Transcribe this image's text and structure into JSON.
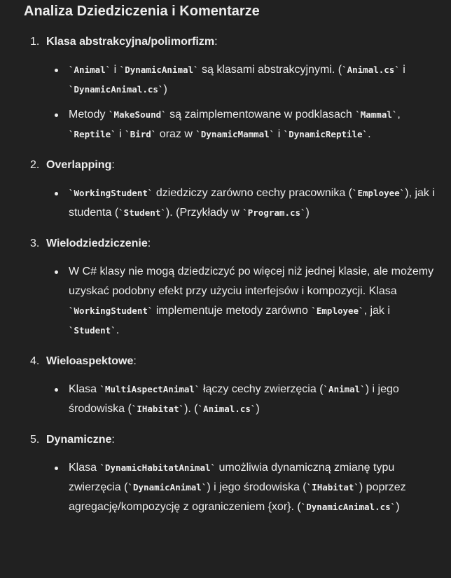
{
  "title": "Analiza Dziedziczenia i Komentarze",
  "sections": [
    {
      "number": "1.",
      "title": "Klasa abstrakcyjna/polimorfizm",
      "bullets": [
        [
          {
            "t": "code",
            "v": "`Animal`"
          },
          {
            "t": "text",
            "v": " i "
          },
          {
            "t": "code",
            "v": "`DynamicAnimal`"
          },
          {
            "t": "text",
            "v": " są klasami abstrakcyjnymi. ("
          },
          {
            "t": "code",
            "v": "`Animal.cs`"
          },
          {
            "t": "text",
            "v": " i "
          },
          {
            "t": "code",
            "v": "`DynamicAnimal.cs`"
          },
          {
            "t": "text",
            "v": ")"
          }
        ],
        [
          {
            "t": "text",
            "v": "Metody "
          },
          {
            "t": "code",
            "v": "`MakeSound`"
          },
          {
            "t": "text",
            "v": " są zaimplementowane w podklasach "
          },
          {
            "t": "code",
            "v": "`Mammal`"
          },
          {
            "t": "text",
            "v": ", "
          },
          {
            "t": "code",
            "v": "`Reptile`"
          },
          {
            "t": "text",
            "v": " i "
          },
          {
            "t": "code",
            "v": "`Bird`"
          },
          {
            "t": "text",
            "v": " oraz w "
          },
          {
            "t": "code",
            "v": "`DynamicMammal`"
          },
          {
            "t": "text",
            "v": " i "
          },
          {
            "t": "code",
            "v": "`DynamicReptile`"
          },
          {
            "t": "text",
            "v": "."
          }
        ]
      ]
    },
    {
      "number": "2.",
      "title": "Overlapping",
      "bullets": [
        [
          {
            "t": "code",
            "v": "`WorkingStudent`"
          },
          {
            "t": "text",
            "v": " dziedziczy zarówno cechy pracownika ("
          },
          {
            "t": "code",
            "v": "`Employee`"
          },
          {
            "t": "text",
            "v": "), jak i studenta ("
          },
          {
            "t": "code",
            "v": "`Student`"
          },
          {
            "t": "text",
            "v": "). (Przykłady w "
          },
          {
            "t": "code",
            "v": "`Program.cs`"
          },
          {
            "t": "text",
            "v": ")"
          }
        ]
      ]
    },
    {
      "number": "3.",
      "title": "Wielodziedziczenie",
      "bullets": [
        [
          {
            "t": "text",
            "v": "W C# klasy nie mogą dziedziczyć po więcej niż jednej klasie, ale możemy uzyskać podobny efekt przy użyciu interfejsów i kompozycji. Klasa "
          },
          {
            "t": "code",
            "v": "`WorkingStudent`"
          },
          {
            "t": "text",
            "v": " implementuje metody zarówno "
          },
          {
            "t": "code",
            "v": "`Employee`"
          },
          {
            "t": "text",
            "v": ", jak i "
          },
          {
            "t": "code",
            "v": "`Student`"
          },
          {
            "t": "text",
            "v": "."
          }
        ]
      ]
    },
    {
      "number": "4.",
      "title": "Wieloaspektowe",
      "bullets": [
        [
          {
            "t": "text",
            "v": "Klasa "
          },
          {
            "t": "code",
            "v": "`MultiAspectAnimal`"
          },
          {
            "t": "text",
            "v": " łączy cechy zwierzęcia ("
          },
          {
            "t": "code",
            "v": "`Animal`"
          },
          {
            "t": "text",
            "v": ") i jego środowiska ("
          },
          {
            "t": "code",
            "v": "`IHabitat`"
          },
          {
            "t": "text",
            "v": "). ("
          },
          {
            "t": "code",
            "v": "`Animal.cs`"
          },
          {
            "t": "text",
            "v": ")"
          }
        ]
      ]
    },
    {
      "number": "5.",
      "title": "Dynamiczne",
      "bullets": [
        [
          {
            "t": "text",
            "v": "Klasa "
          },
          {
            "t": "code",
            "v": "`DynamicHabitatAnimal`"
          },
          {
            "t": "text",
            "v": " umożliwia dynamiczną zmianę typu zwierzęcia ("
          },
          {
            "t": "code",
            "v": "`DynamicAnimal`"
          },
          {
            "t": "text",
            "v": ") i jego środowiska ("
          },
          {
            "t": "code",
            "v": "`IHabitat`"
          },
          {
            "t": "text",
            "v": ") poprzez agregację/kompozycję z ograniczeniem {xor}. ("
          },
          {
            "t": "code",
            "v": "`DynamicAnimal.cs`"
          },
          {
            "t": "text",
            "v": ")"
          }
        ]
      ]
    }
  ]
}
